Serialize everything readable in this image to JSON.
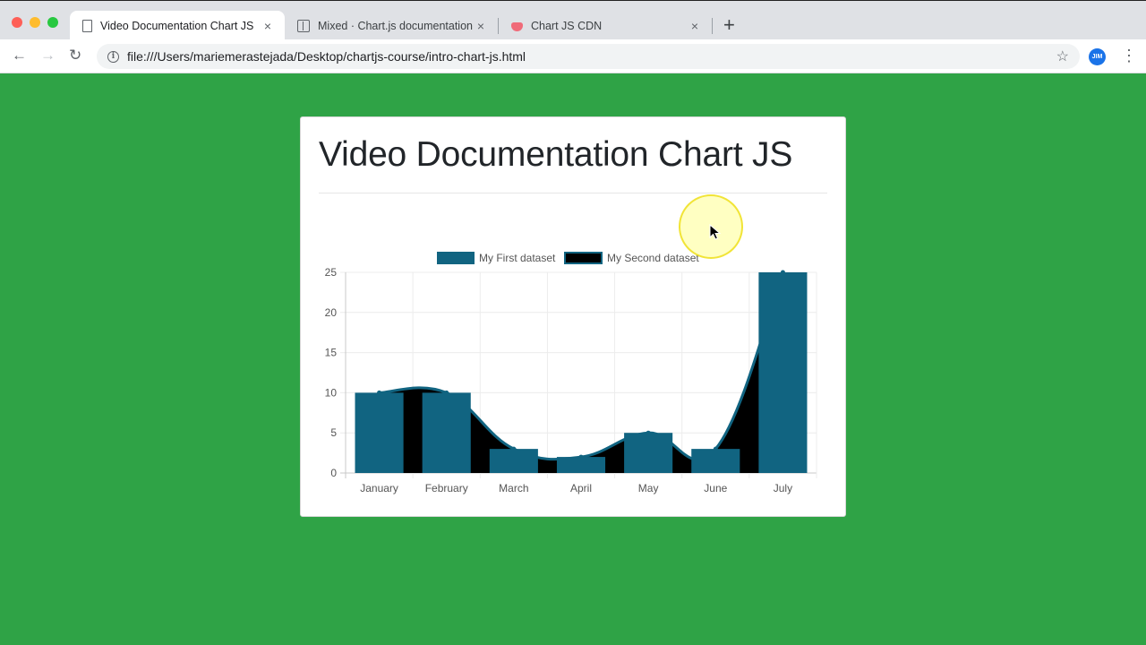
{
  "browser": {
    "tabs": [
      {
        "title": "Video Documentation Chart JS",
        "icon": "page-icon",
        "active": true
      },
      {
        "title": "Mixed · Chart.js documentation",
        "icon": "book-icon",
        "active": false
      },
      {
        "title": "Chart JS CDN",
        "icon": "cup-icon",
        "active": false
      }
    ],
    "close_glyph": "×",
    "new_tab_glyph": "+",
    "url": "file:///Users/mariemerastejada/Desktop/chartjs-course/intro-chart-js.html",
    "extension_label": "JIM"
  },
  "page": {
    "heading": "Video Documentation Chart JS"
  },
  "colors": {
    "background": "#2fa346",
    "bar": "#116481",
    "area_fill": "#000000",
    "line": "#116481"
  },
  "chart_data": {
    "type": "bar",
    "categories": [
      "January",
      "February",
      "March",
      "April",
      "May",
      "June",
      "July"
    ],
    "series": [
      {
        "name": "My First dataset",
        "type": "bar",
        "values": [
          10,
          10,
          3,
          2,
          5,
          3,
          25
        ]
      },
      {
        "name": "My Second dataset",
        "type": "area",
        "values": [
          10,
          10,
          3,
          2,
          5,
          3,
          25
        ]
      }
    ],
    "y_ticks": [
      "0",
      "5",
      "10",
      "15",
      "20",
      "25"
    ],
    "ylim": [
      0,
      25
    ],
    "grid": true,
    "legend": "top"
  }
}
